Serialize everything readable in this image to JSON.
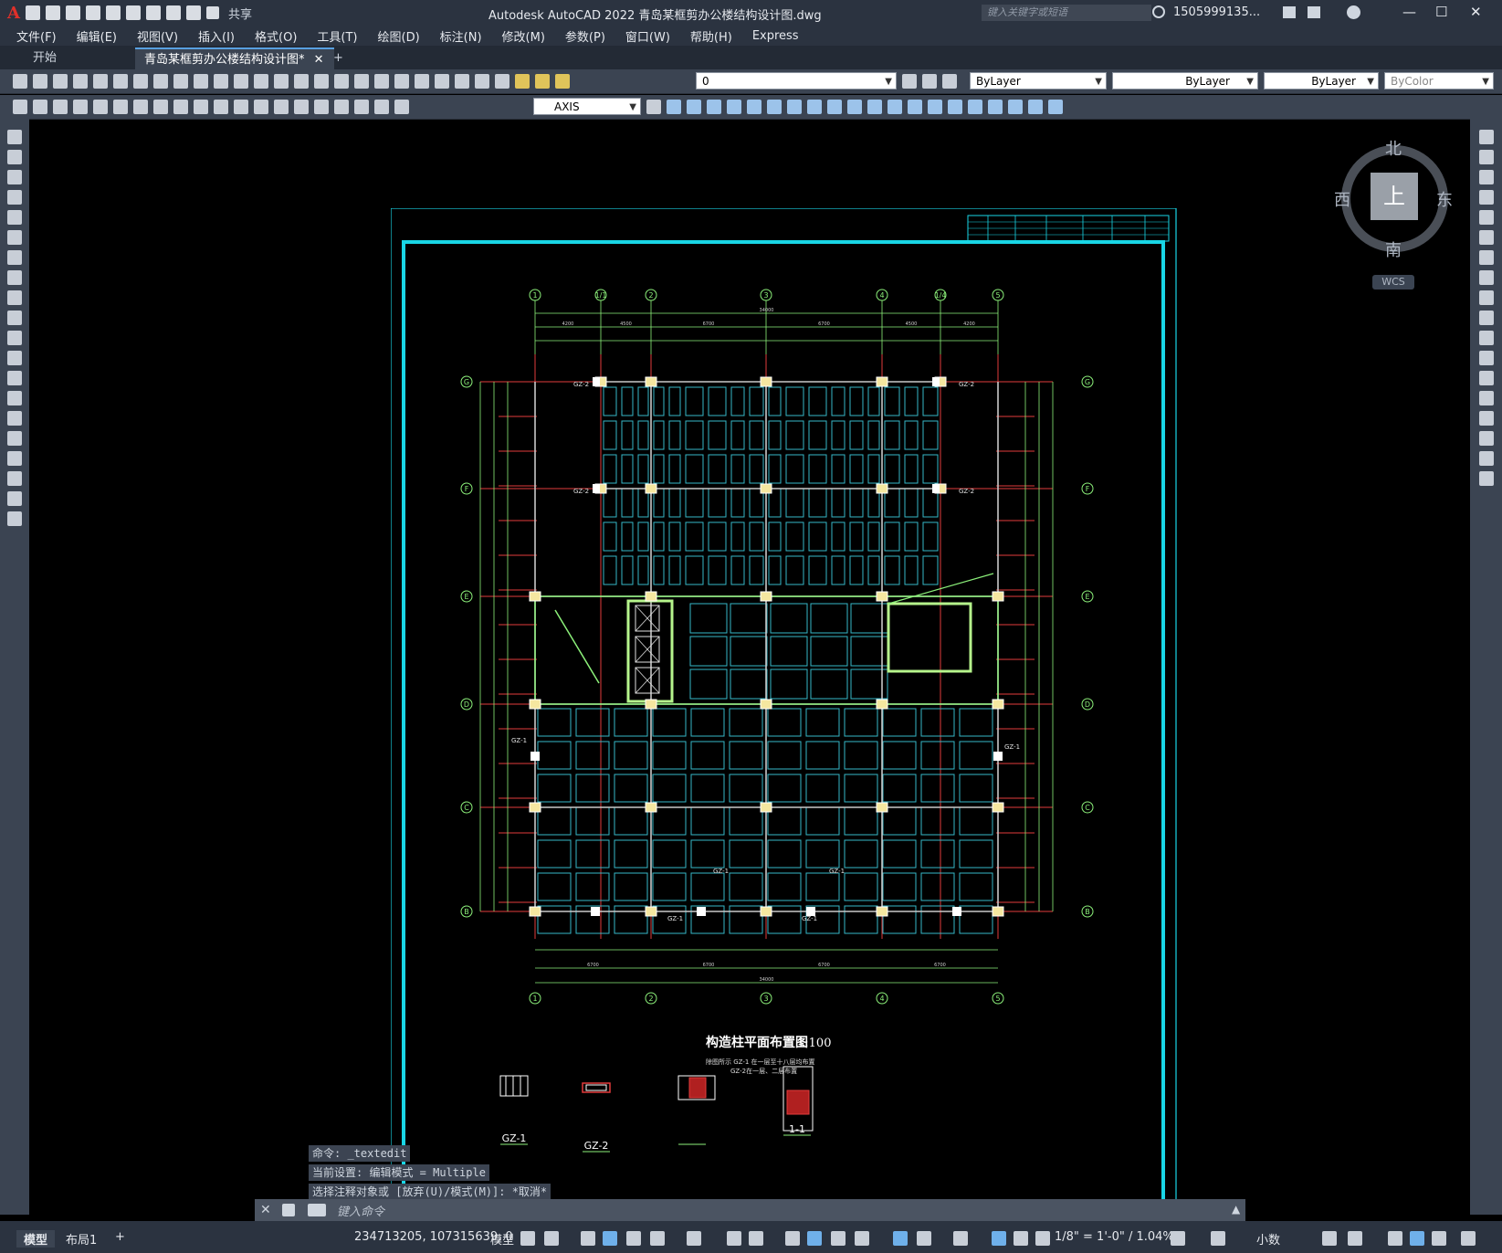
{
  "title_bar": {
    "app_logo": "A",
    "share_label": "共享",
    "window_title": "Autodesk AutoCAD 2022    青岛某框剪办公楼结构设计图.dwg",
    "search_placeholder": "键入关键字或短语",
    "user_name": "1505999135...",
    "minimize": "—",
    "maximize": "☐",
    "close": "✕"
  },
  "menu": [
    "文件(F)",
    "编辑(E)",
    "视图(V)",
    "插入(I)",
    "格式(O)",
    "工具(T)",
    "绘图(D)",
    "标注(N)",
    "修改(M)",
    "参数(P)",
    "窗口(W)",
    "帮助(H)",
    "Express"
  ],
  "tabs": {
    "start": "开始",
    "document": "青岛某框剪办公楼结构设计图*",
    "close": "✕",
    "add": "+"
  },
  "properties": {
    "layer": "0",
    "color": "ByLayer",
    "linetype": "ByLayer",
    "lineweight": "ByLayer",
    "plotstyle": "ByColor",
    "dimstyle": "AXIS"
  },
  "viewcube": {
    "north": "北",
    "south": "南",
    "east": "东",
    "west": "西",
    "top": "上",
    "wcs": "WCS"
  },
  "drawing": {
    "grid_x_labels": [
      "1",
      "1/1",
      "2",
      "3",
      "4",
      "1/4",
      "5"
    ],
    "grid_y_labels": [
      "G",
      "F",
      "E",
      "D",
      "C",
      "B"
    ],
    "overall_width": "34000",
    "bay_labels": [
      "6700",
      "6700",
      "6700",
      "6700"
    ],
    "top_dims": [
      "4200",
      "4500",
      "6700",
      "6700",
      "4500",
      "4200"
    ],
    "tags": [
      "GZ-2",
      "GZ-2",
      "GZ-2",
      "GZ-2",
      "GZ-1",
      "GZ-1",
      "GZ-1",
      "GZ-1",
      "GZ-1",
      "GZ-1"
    ],
    "plan_title": "构造柱平面布置图",
    "plan_scale": "1:100",
    "note_line1": "除图所示 GZ-1 在一层至十八层均布置",
    "note_line2": "GZ-2在一层、二层布置",
    "detail_labels": [
      "GZ-1",
      "GZ-2",
      "",
      "1-1"
    ]
  },
  "command_history": [
    "命令: _textedit",
    "当前设置: 编辑模式 = Multiple",
    "选择注释对象或 [放弃(U)/模式(M)]: *取消*"
  ],
  "command_input_placeholder": "键入命令",
  "status_bar": {
    "model_tab": "模型",
    "layout_tab": "布局1",
    "add_layout": "+",
    "coordinates": "234713205, 107315639, 0",
    "model_space": "模型",
    "scale": "1/8\" = 1'-0\" / 1.04%",
    "units": "小数"
  }
}
